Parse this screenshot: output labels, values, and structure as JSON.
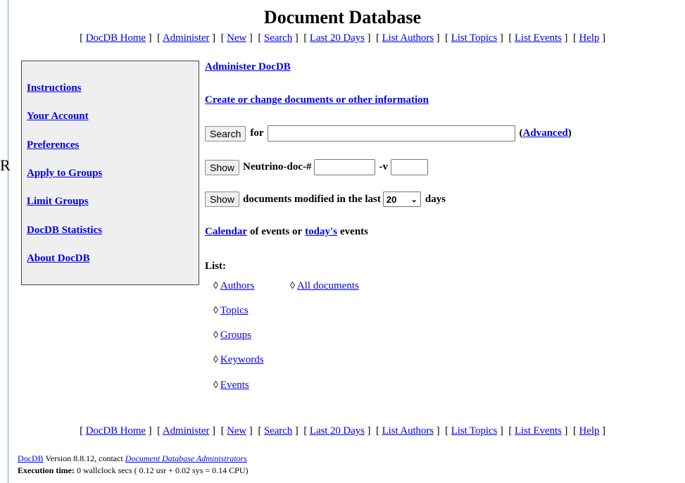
{
  "header": {
    "title": "Document Database"
  },
  "nav": {
    "items": [
      "DocDB Home",
      "Administer",
      "New",
      "Search",
      "Last 20 Days",
      "List Authors",
      "List Topics",
      "List Events",
      "Help"
    ]
  },
  "sidebar": {
    "items": [
      "Instructions",
      "Your Account",
      "Preferences",
      "Apply to Groups",
      "Limit Groups",
      "DocDB Statistics",
      "About DocDB"
    ]
  },
  "main": {
    "administer_link": "Administer DocDB",
    "create_link": "Create or change documents or other information",
    "search": {
      "button": "Search",
      "for_label": "for",
      "value": "",
      "advanced_label": "Advanced"
    },
    "show_doc": {
      "button": "Show",
      "label": "Neutrino-doc-#",
      "doc_value": "",
      "version_label": "-v",
      "version_value": ""
    },
    "modified": {
      "button": "Show",
      "label": "documents modified in the last",
      "days_value": "20",
      "days_label": "days"
    },
    "calendar": {
      "calendar_link": "Calendar",
      "middle_text": "of events or",
      "today_link": "today's",
      "end_text": "events"
    },
    "list": {
      "label": "List:",
      "items": [
        "Authors",
        "All documents",
        "Topics",
        "Groups",
        "Keywords",
        "Events"
      ]
    }
  },
  "footer": {
    "docdb_link": "DocDB",
    "version_text": "Version 8.8.12, contact",
    "admins_link": "Document Database Administrators",
    "exec_label": "Execution time:",
    "exec_text": "0 wallclock secs ( 0.12 usr + 0.02 sys = 0.14 CPU)"
  },
  "edge_glyph": "R"
}
